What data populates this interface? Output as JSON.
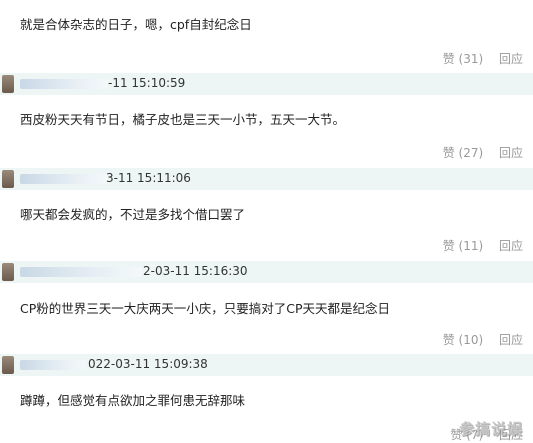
{
  "comments": [
    {
      "timestamp": "",
      "text": "就是合体杂志的日子，嗯，cpf自封纪念日",
      "likes": "赞 (31)",
      "reply": "回应"
    },
    {
      "timestamp": "-11 15:10:59",
      "text": "西皮粉天天有节日，橘子皮也是三天一小节，五天一大节。",
      "likes": "赞 (27)",
      "reply": "回应"
    },
    {
      "timestamp": "3-11 15:11:06",
      "text": "哪天都会发疯的，不过是多找个借口罢了",
      "likes": "赞 (11)",
      "reply": "回应"
    },
    {
      "timestamp": "2-03-11 15:16:30",
      "text": "CP粉的世界三天一大庆两天一小庆，只要搞对了CP天天都是纪念日",
      "likes": "赞 (10)",
      "reply": "回应"
    },
    {
      "timestamp": "022-03-11 15:09:38",
      "text": "蹲蹲，但感觉有点欲加之罪何患无辞那味",
      "likes": "赞 (7)",
      "reply": "回应"
    }
  ],
  "watermark": "参搞说娱"
}
